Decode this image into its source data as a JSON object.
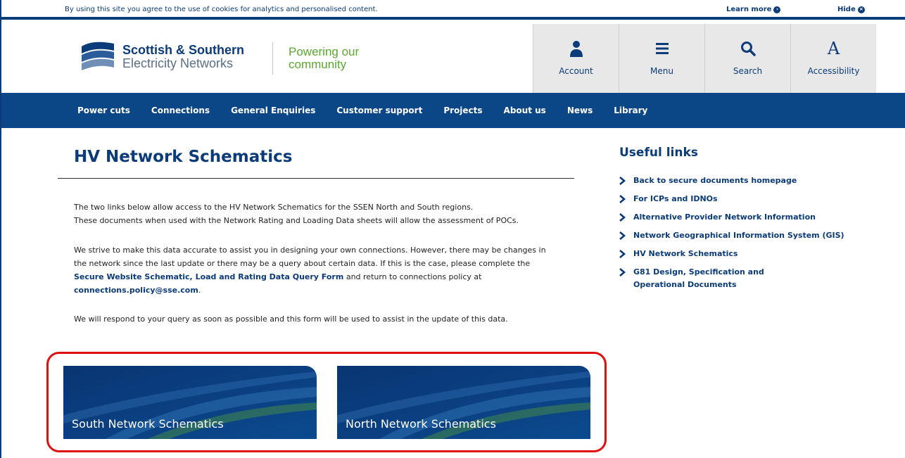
{
  "cookie_bar": {
    "text": "By using this site you agree to the use of cookies for analytics and personalised content.",
    "learn_more": "Learn more",
    "hide": "Hide"
  },
  "header": {
    "logo_line1": "Scottish & Southern",
    "logo_line2": "Electricity Networks",
    "tagline_line1": "Powering our",
    "tagline_line2": "community",
    "tools": [
      {
        "label": "Account",
        "icon": "person-icon"
      },
      {
        "label": "Menu",
        "icon": "hamburger-menu-icon"
      },
      {
        "label": "Search",
        "icon": "search-icon"
      },
      {
        "label": "Accessibility",
        "icon": "accessibility-a-icon"
      }
    ]
  },
  "nav": {
    "items": [
      "Power cuts",
      "Connections",
      "General Enquiries",
      "Customer support",
      "Projects",
      "About us",
      "News",
      "Library"
    ]
  },
  "main": {
    "title": "HV Network Schematics",
    "p1_line1": "The two links below allow access to the HV Network Schematics for the SSEN North and South regions.",
    "p1_line2": "These documents when used with the Network Rating and Loading Data sheets will allow the assessment of POCs.",
    "p2_line1": "We strive to make this data accurate to assist you in designing your own connections. However, there may be changes in",
    "p2_line2": "the network since the last update or there may be a query about certain data. If this is the case, please complete the",
    "p2_link": "Secure Website Schematic, Load and Rating Data Query Form",
    "p2_after_link": " and return to connections policy at",
    "p2_email": "connections.policy@sse.com",
    "p2_end": ".",
    "p3": "We will respond to your query as soon as possible and this form will be used to assist in the update of this data.",
    "tiles": [
      {
        "label": "South Network Schematics"
      },
      {
        "label": "North Network Schematics"
      }
    ]
  },
  "sidebar": {
    "title": "Useful links",
    "links": [
      "Back to secure documents homepage",
      "For ICPs and IDNOs",
      "Alternative Provider Network Information",
      "Network Geographical Information System (GIS)",
      "HV Network Schematics",
      "G81 Design, Specification and Operational Documents"
    ]
  },
  "colors": {
    "brand_blue": "#0b3b78",
    "nav_blue": "#0b4687",
    "tagline_green": "#5aa82c",
    "highlight_red": "#e01010"
  }
}
